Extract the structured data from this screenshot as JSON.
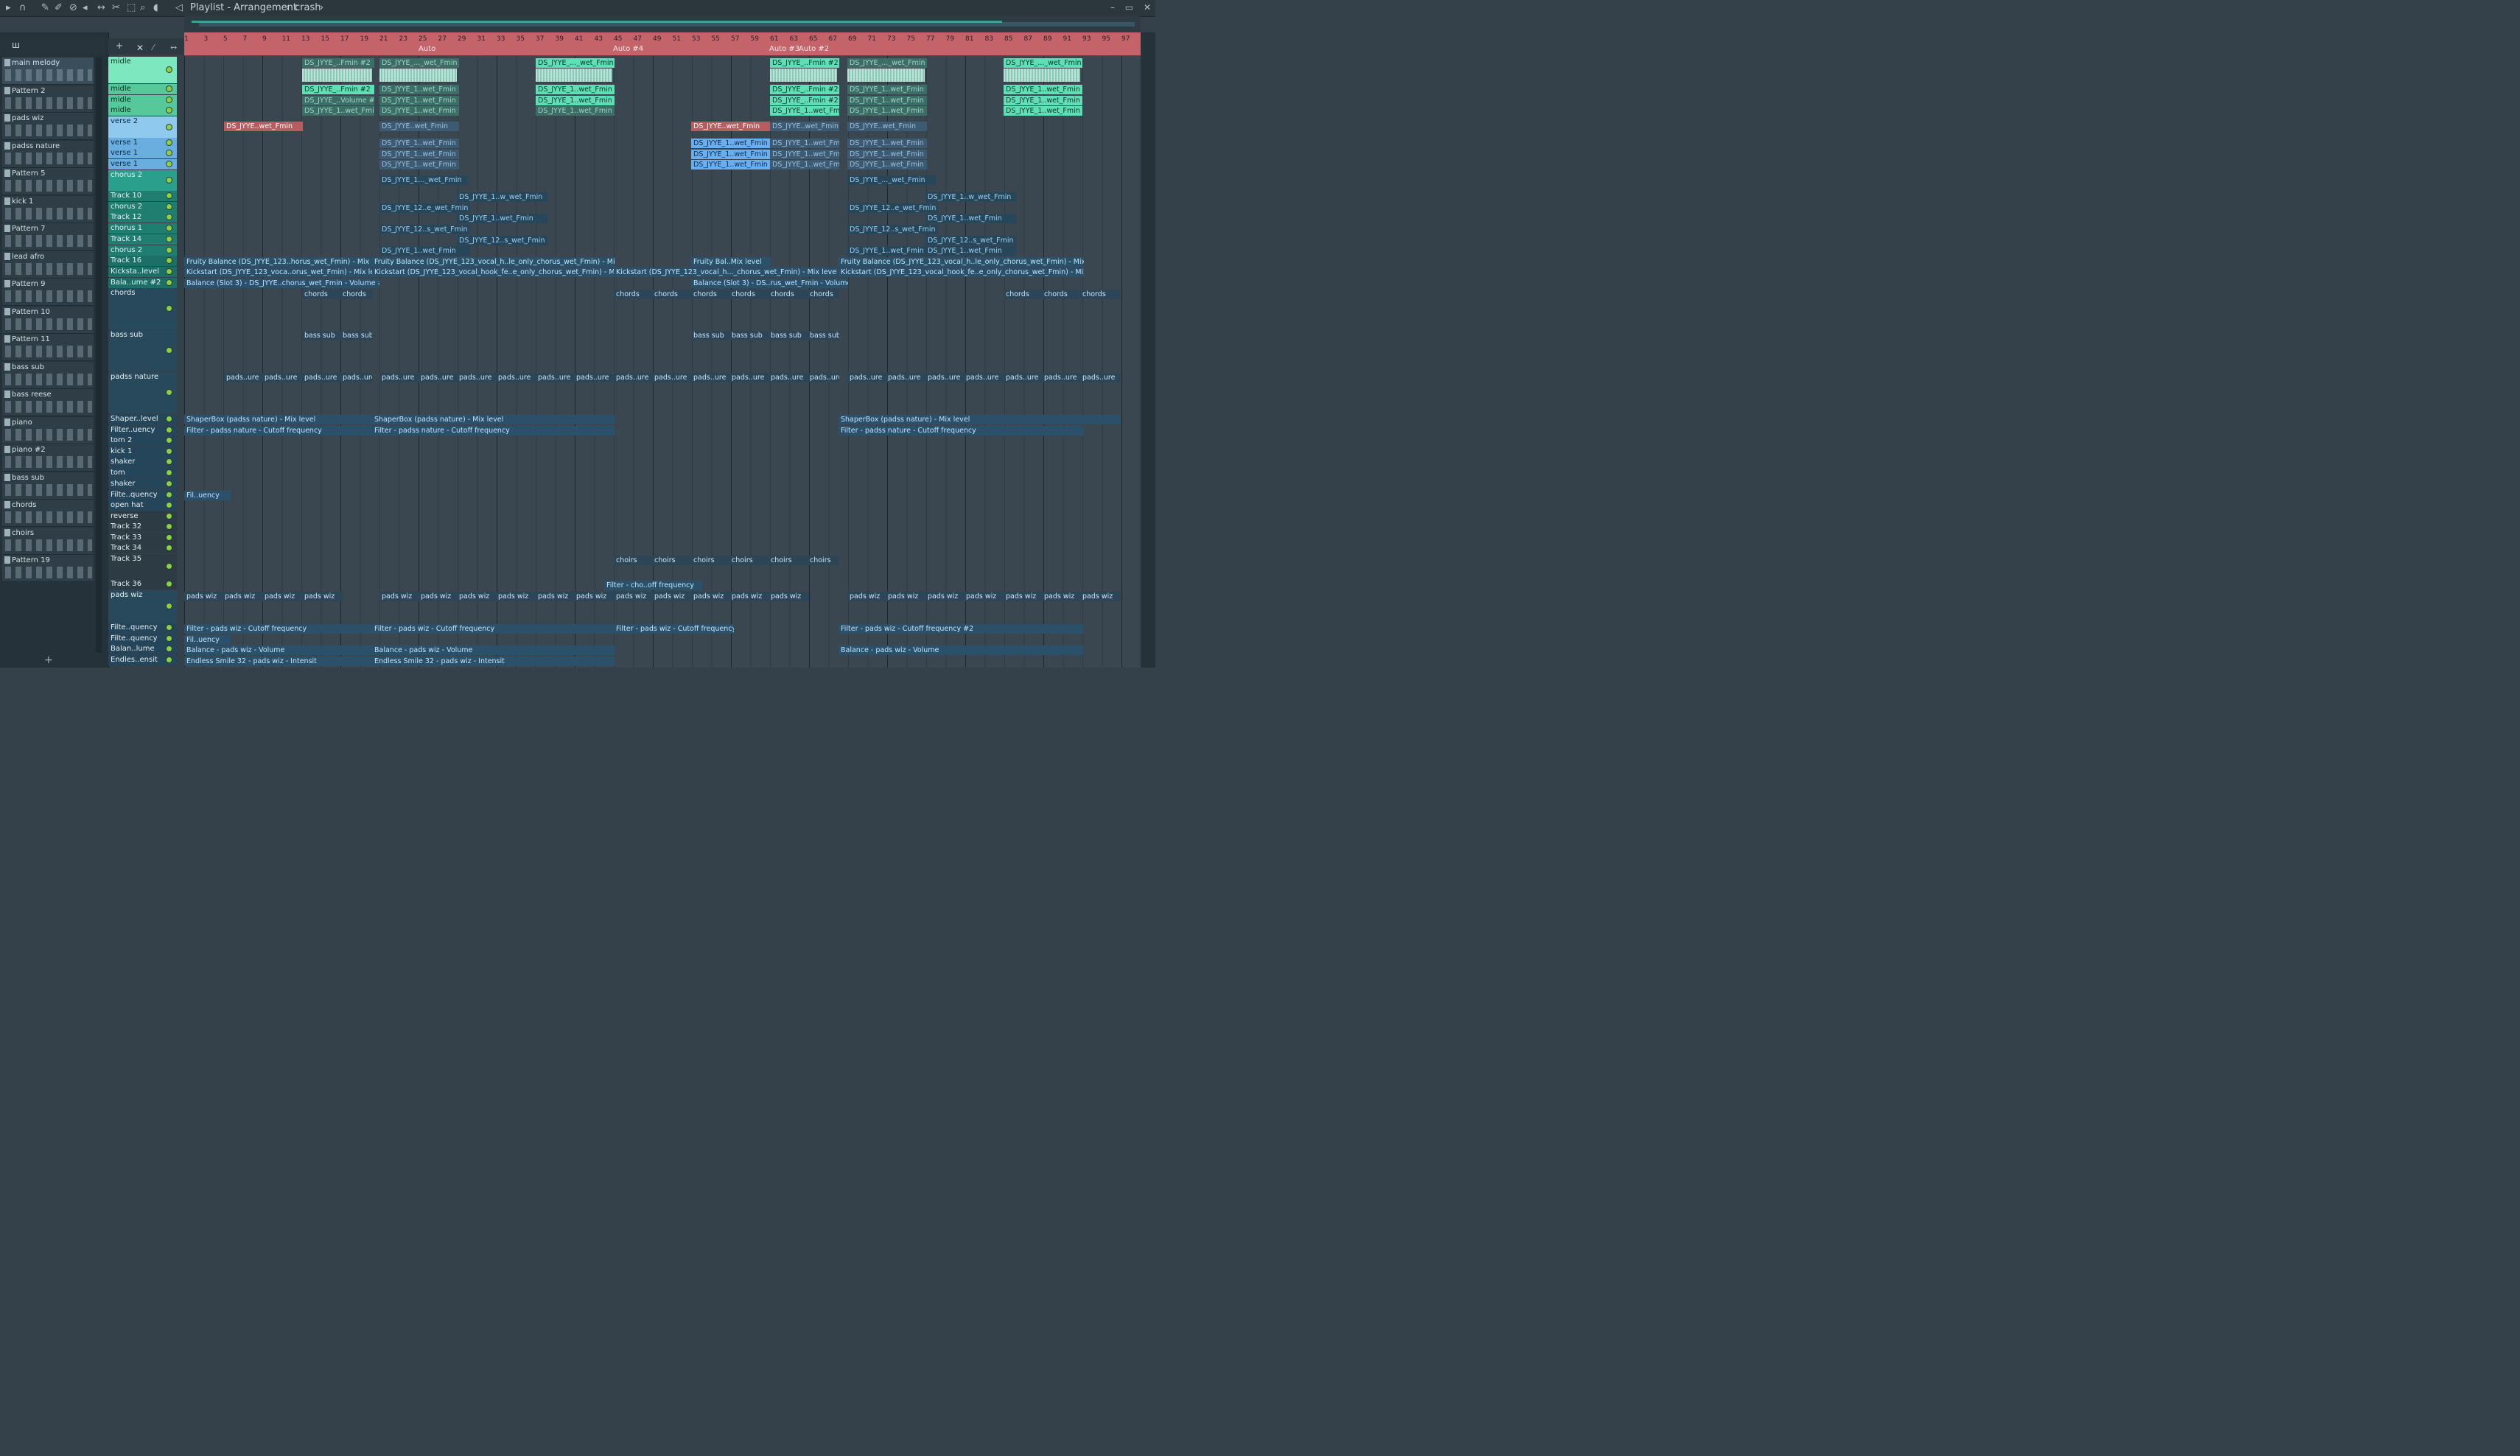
{
  "titlebar": {
    "title": "Playlist - Arrangement",
    "crumb": "crash"
  },
  "ruler": {
    "bars": [
      "1",
      "3",
      "5",
      "7",
      "9",
      "11",
      "13",
      "15",
      "17",
      "19",
      "21",
      "23",
      "25",
      "27",
      "29",
      "31",
      "33",
      "35",
      "37",
      "39",
      "41",
      "43",
      "45",
      "47",
      "49",
      "51",
      "53",
      "55",
      "57",
      "59",
      "61",
      "63",
      "65",
      "67",
      "69",
      "71",
      "73",
      "75",
      "77",
      "79",
      "81",
      "83",
      "85",
      "87",
      "89",
      "91",
      "93",
      "95",
      "97"
    ],
    "markers": [
      "Auto",
      "Auto #4",
      "Auto #3",
      "Auto #2"
    ]
  },
  "picker": {
    "items": [
      "main melody",
      "Pattern 2",
      "pads wiz",
      "padss nature",
      "Pattern 5",
      "kick 1",
      "Pattern 7",
      "lead afro",
      "Pattern 9",
      "Pattern 10",
      "Pattern 11",
      "bass sub",
      "bass reese",
      "piano",
      "piano #2",
      "bass sub",
      "chords",
      "choirs",
      "Pattern 19"
    ],
    "add": "+"
  },
  "tracks": [
    "midle",
    "midle",
    "midle",
    "midle",
    "verse 2",
    "verse 1",
    "verse 1",
    "verse 1",
    "chorus 2",
    "Track 10",
    "chorus 2",
    "Track 12",
    "chorus 1",
    "Track 14",
    "chorus 2",
    "Track 16",
    "Kicksta..level",
    "Bala..ume #2",
    "chords",
    "bass sub",
    "padss nature",
    "Shaper..level",
    "Filter..uency",
    "tom 2",
    "kick 1",
    "shaker",
    "tom",
    "shaker",
    "Filte..quency",
    "open hat",
    "reverse",
    "Track 32",
    "Track 33",
    "Track 34",
    "Track 35",
    "Track 36",
    "pads wiz",
    "Filte..quency",
    "Filte..quency",
    "Balan..lume",
    "Endles..ensit"
  ],
  "clips": {
    "midle_a": "DS_JYYE_..Fmin #2",
    "midle_b": "DS_JYYE_..._wet_Fmin",
    "midle_c": "DS_JYYE_1..wet_Fmin",
    "midle_d": "DS_JYYE_..Volume #2",
    "verse2": "DS_JYYE..wet_Fmin",
    "verse1": "DS_JYYE_1..wet_Fmin",
    "chorus2": "DS_JYYE_1..._wet_Fmin",
    "chorus2b": "DS_JYYE_..._wet_Fmin",
    "t10": "DS_JYYE_1..w_wet_Fmin",
    "c2a": "DS_JYYE_12..e_wet_Fmin",
    "t12": "DS_JYYE_1..wet_Fmin",
    "c1": "DS_JYYE_12..s_wet_Fmin",
    "t14": "DS_JYYE_12..s_wet_Fmin",
    "fb": "Fruity Balance (DS_JYYE_123..horus_wet_Fmin) - Mix level",
    "fb2": "Fruity Balance (DS_JYYE_123_vocal_h..le_only_chorus_wet_Fmin) - Mix level",
    "fb3": "Fruity Bal..Mix level",
    "ks": "Kickstart (DS_JYYE_123_voca..orus_wet_Fmin) - Mix level",
    "ks2": "Kickstart (DS_JYYE_123_vocal_hook_fe..e_only_chorus_wet_Fmin) - Mix level",
    "ks3": "Kickstart (DS_JYYE_123_vocal_h..._chorus_wet_Fmin) - Mix level",
    "bal": "Balance (Slot 3) - DS_JYYE..chorus_wet_Fmin - Volume #2",
    "bal2": "Balance (Slot 3) - DS..rus_wet_Fmin - Volume",
    "chords": "chords",
    "bass": "bass sub",
    "pads": "pads..ure",
    "shaper": "ShaperBox (padss nature) - Mix level",
    "filter": "Filter - padss nature - Cutoff frequency",
    "filtpad": "Filter - pads wiz - Cutoff frequency",
    "filtpad2": "Filter - pads wiz - Cutoff frequency #2",
    "filu": "Fil..uency",
    "choirs": "choirs",
    "filtcho": "Filter - cho..off frequency",
    "padswiz": "pads wiz",
    "balpad": "Balance - pads wiz - Volume",
    "endless": "Endless Smile 32 - pads wiz - Intensit"
  }
}
